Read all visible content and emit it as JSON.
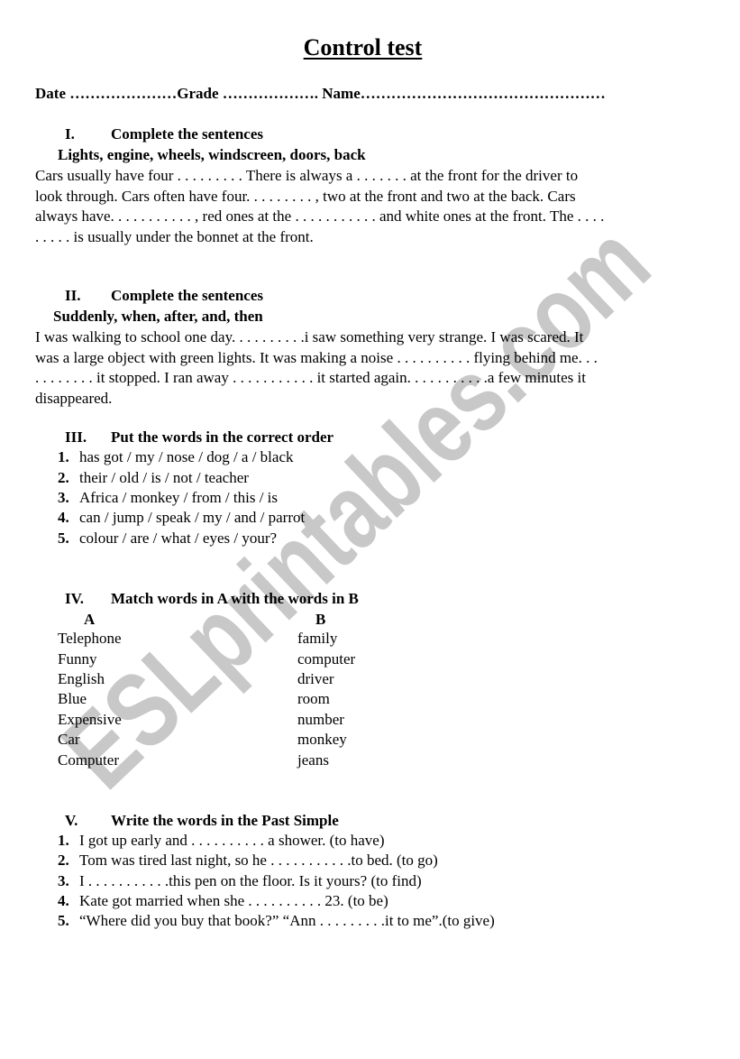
{
  "watermark": {
    "text": "ESLprintables.com",
    "color": "#c8c8c8"
  },
  "document": {
    "title": "Control test",
    "header_line": "Date …………………Grade ………………. Name…………………………………………"
  },
  "sections": [
    {
      "number": "I.",
      "heading": "Complete the sentences",
      "word_bank": "Lights, engine, wheels, windscreen, doors, back",
      "lines": [
        "Cars usually have four . . . . . . . . . There is always a . . . . . . . at the front for the driver to",
        "look through. Cars often have four. . . . . . . . . , two at the front and two at the back. Cars",
        "always have. . . . . . . . . . . , red ones at the . . . . . . . . . . . and white ones at the front. The . . . .",
        ". . . . . is usually under the bonnet at the front."
      ]
    },
    {
      "number": "II.",
      "heading": "Complete the sentences",
      "word_bank": "Suddenly, when, after, and, then",
      "lines": [
        "I was walking to school one day.  . . . . . . . . .i saw something very strange. I was scared.  It",
        "was a large object with green lights. It was making a noise . . . . . . . . . . flying behind me.  . .",
        ". . . . . . . . it stopped. I ran away  . . . . . . . . . . . it started again.  . . . . . . . . . .a few minutes it",
        "disappeared."
      ]
    },
    {
      "number": "III.",
      "heading": "Put the words in the correct order",
      "items": [
        {
          "num": "1.",
          "text": "has got / my / nose / dog / a / black"
        },
        {
          "num": "2.",
          "text": "their / old / is / not / teacher"
        },
        {
          "num": "3.",
          "text": "Africa / monkey / from / this / is"
        },
        {
          "num": "4.",
          "text": "can / jump / speak / my / and / parrot"
        },
        {
          "num": "5.",
          "text": "colour / are / what / eyes / your?"
        }
      ]
    },
    {
      "number": "IV.",
      "heading": "Match words in A with the words in B",
      "column_a_label": "A",
      "column_b_label": "B",
      "column_a": [
        "Telephone",
        "Funny",
        "English",
        "Blue",
        "Expensive",
        "Car",
        "Computer"
      ],
      "column_b": [
        "family",
        "computer",
        "driver",
        "room",
        "number",
        "monkey",
        "jeans"
      ]
    },
    {
      "number": "V.",
      "heading": "Write the words in the Past Simple",
      "items": [
        {
          "num": "1.",
          "text": "I got up early and . . . . . . . . . . a shower. (to have)"
        },
        {
          "num": "2.",
          "text": "Tom was tired last night, so he . . . . . . . . . . .to bed. (to go)"
        },
        {
          "num": "3.",
          "text": "I . . . . . . . . . . .this pen on the floor. Is it yours? (to find)"
        },
        {
          "num": "4.",
          "text": "Kate got married when she . . . . . . . . . . 23. (to be)"
        },
        {
          "num": "5.",
          "text": "“Where did you buy that book?” “Ann . . . . . . . . .it to me”.(to give)"
        }
      ]
    }
  ]
}
